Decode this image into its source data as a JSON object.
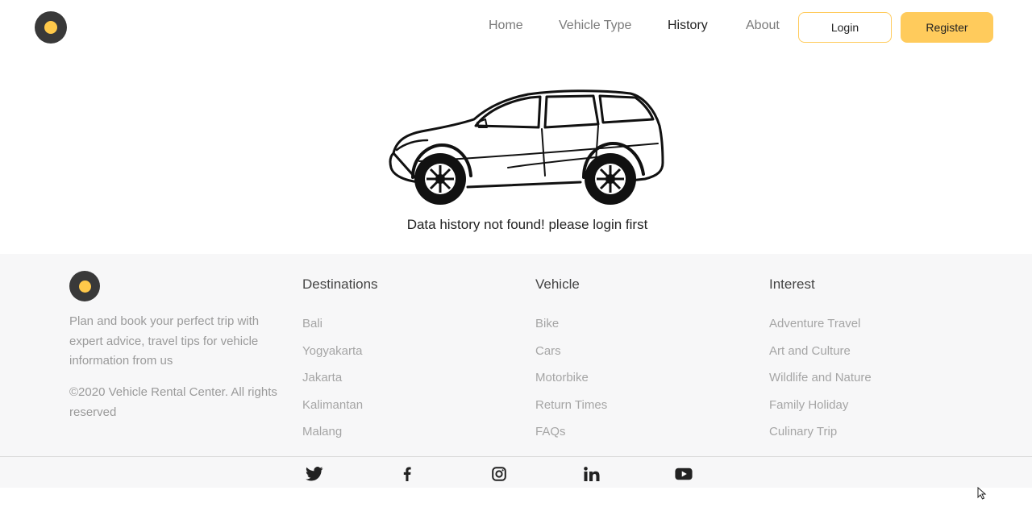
{
  "header": {
    "nav": [
      "Home",
      "Vehicle Type",
      "History",
      "About"
    ],
    "active_nav": "History",
    "login_label": "Login",
    "register_label": "Register"
  },
  "main": {
    "illustration": "car-icon",
    "empty_message": "Data history not found! please login first"
  },
  "footer": {
    "description": "Plan and book your perfect trip with expert advice, travel tips for vehicle information from us",
    "copyright": "©2020 Vehicle Rental Center. All rights reserved",
    "columns": [
      {
        "title": "Destinations",
        "links": [
          "Bali",
          "Yogyakarta",
          "Jakarta",
          "Kalimantan",
          "Malang"
        ]
      },
      {
        "title": "Vehicle",
        "links": [
          "Bike",
          "Cars",
          "Motorbike",
          "Return Times",
          "FAQs"
        ]
      },
      {
        "title": "Interest",
        "links": [
          "Adventure Travel",
          "Art and Culture",
          "Wildlife and Nature",
          "Family Holiday",
          "Culinary Trip"
        ]
      }
    ],
    "social_icons": [
      "twitter-icon",
      "facebook-icon",
      "instagram-icon",
      "linkedin-icon",
      "youtube-icon"
    ]
  },
  "colors": {
    "accent": "#FFCB5C",
    "logo_dark": "#393939",
    "footer_bg": "#f7f7f8",
    "muted_text": "#a5a5a5"
  }
}
